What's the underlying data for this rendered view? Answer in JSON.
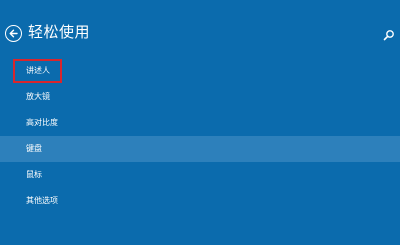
{
  "header": {
    "title": "轻松使用",
    "back_icon": "arrow-left-circle-icon",
    "search_icon": "search-icon"
  },
  "menu": {
    "items": [
      {
        "label": "讲述人",
        "highlighted": true,
        "selected": false
      },
      {
        "label": "放大镜",
        "highlighted": false,
        "selected": false
      },
      {
        "label": "高对比度",
        "highlighted": false,
        "selected": false
      },
      {
        "label": "键盘",
        "highlighted": false,
        "selected": true
      },
      {
        "label": "鼠标",
        "highlighted": false,
        "selected": false
      },
      {
        "label": "其他选项",
        "highlighted": false,
        "selected": false
      }
    ]
  },
  "colors": {
    "background": "#0b6bad",
    "selected_row": "#2d80bb",
    "highlight_box": "#d9262c",
    "text": "#ffffff"
  }
}
